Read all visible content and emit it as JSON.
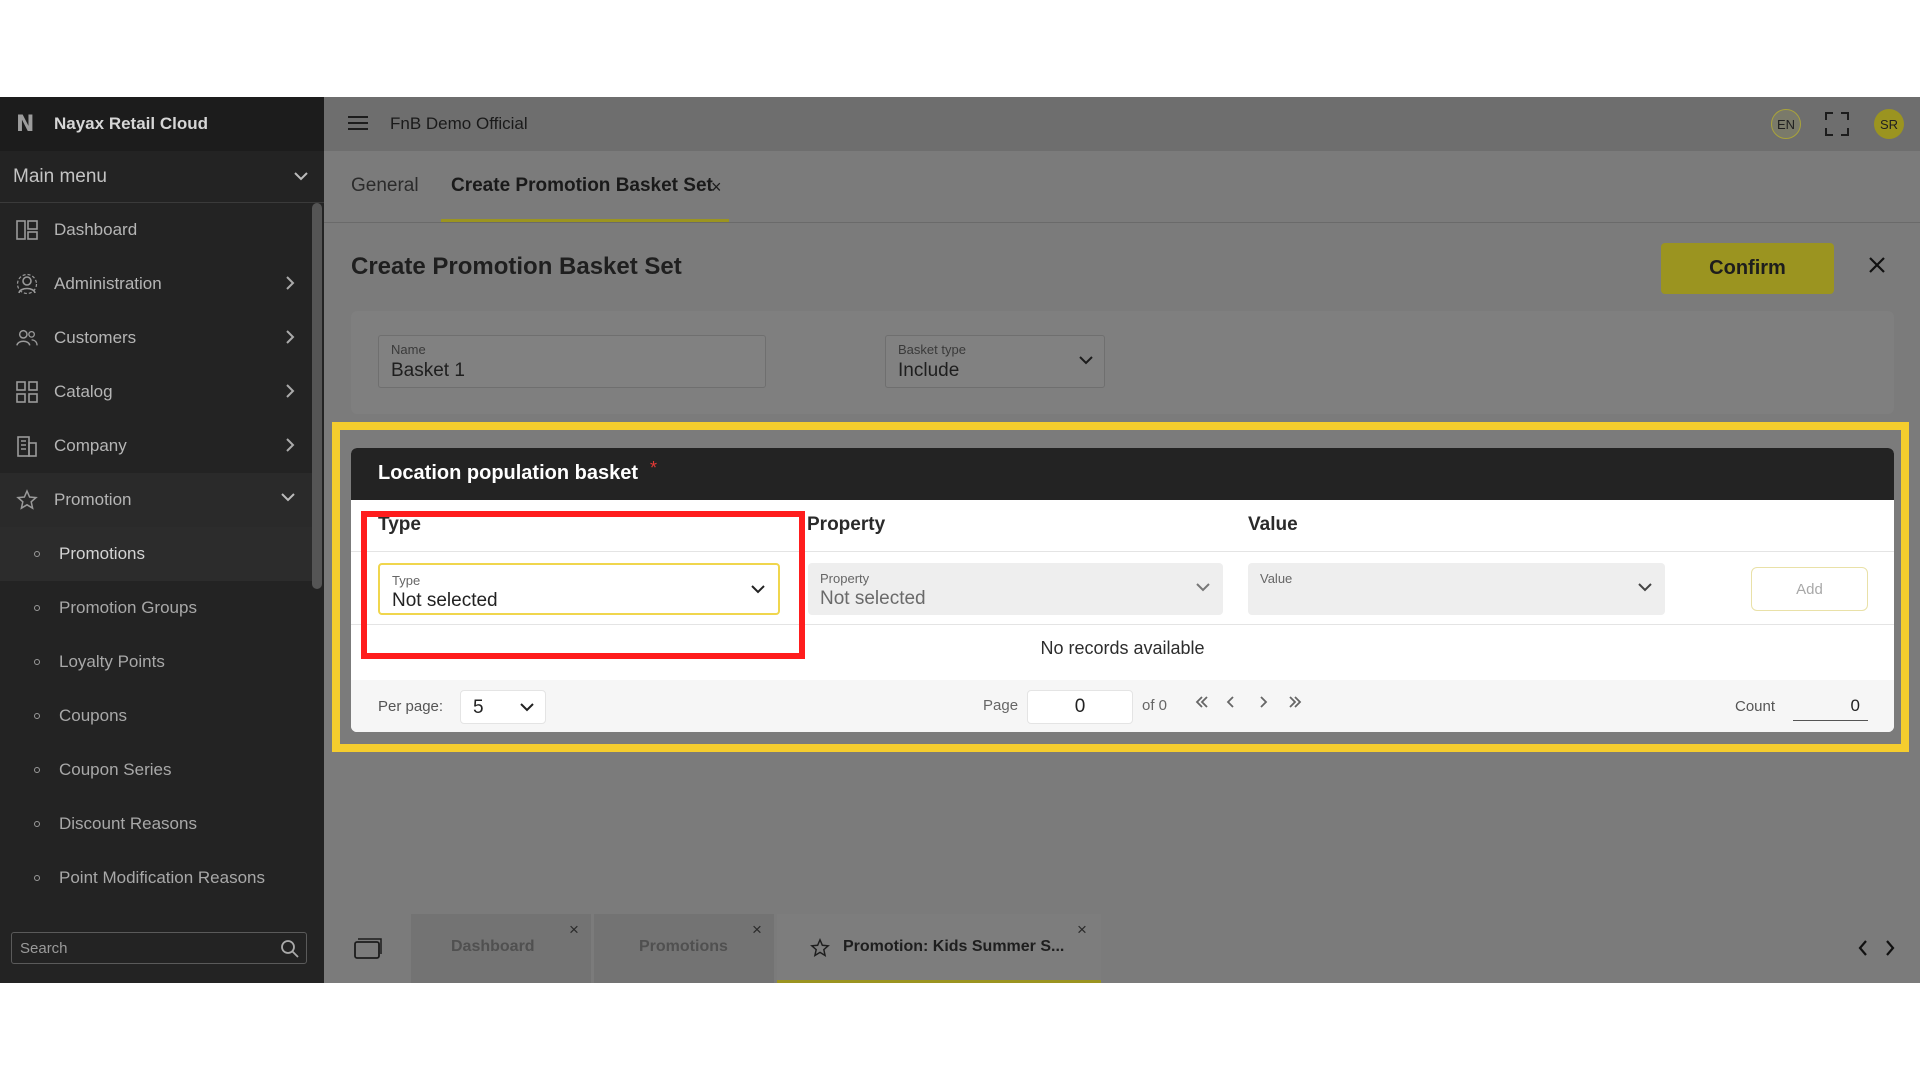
{
  "sidebar": {
    "brand_logo": "N",
    "brand": "Nayax Retail Cloud",
    "main_menu": "Main menu",
    "items": [
      {
        "label": "Dashboard",
        "icon": "dashboard-icon"
      },
      {
        "label": "Administration",
        "icon": "administration-icon"
      },
      {
        "label": "Customers",
        "icon": "customers-icon"
      },
      {
        "label": "Catalog",
        "icon": "catalog-icon"
      },
      {
        "label": "Company",
        "icon": "company-icon"
      },
      {
        "label": "Promotion",
        "icon": "star-icon"
      }
    ],
    "promotion_children": [
      "Promotions",
      "Promotion Groups",
      "Loyalty Points",
      "Coupons",
      "Coupon Series",
      "Discount Reasons",
      "Point Modification Reasons"
    ],
    "search_placeholder": "Search"
  },
  "topbar": {
    "title": "FnB Demo Official",
    "lang": "EN",
    "avatar": "SR"
  },
  "tabs": {
    "general": "General",
    "create": "Create Promotion Basket Set",
    "close": "×"
  },
  "page": {
    "title": "Create Promotion Basket Set",
    "confirm": "Confirm",
    "name_label": "Name",
    "name_value": "Basket 1",
    "basket_type_label": "Basket type",
    "basket_type_value": "Include"
  },
  "basket": {
    "title": "Location population basket",
    "required_mark": "*",
    "columns": [
      "Type",
      "Property",
      "Value"
    ],
    "type_label": "Type",
    "type_value": "Not selected",
    "property_label": "Property",
    "property_value": "Not selected",
    "value_label": "Value",
    "add": "Add",
    "empty": "No records available",
    "per_page_label": "Per page:",
    "per_page": "5",
    "page_label": "Page",
    "page_value": "0",
    "of_label": "of 0",
    "count_label": "Count",
    "count_value": "0"
  },
  "bottom_tabs": [
    {
      "label": "Dashboard",
      "close": "×"
    },
    {
      "label": "Promotions",
      "close": "×"
    },
    {
      "label": "Promotion: Kids Summer S...",
      "close": "×"
    }
  ],
  "colors": {
    "accent": "#9b9420",
    "highlight_yellow": "#f5cd2e",
    "highlight_red": "#ff1d1d",
    "sidebar_bg": "#232323"
  }
}
